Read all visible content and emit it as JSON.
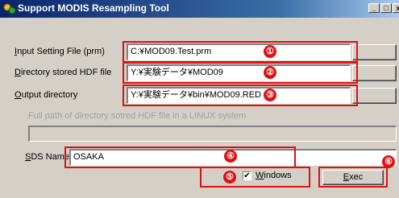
{
  "window": {
    "title": "Support MODIS Resampling Tool",
    "minimize_glyph": "_",
    "maximize_glyph": "□",
    "close_glyph": "x"
  },
  "form": {
    "input_setting": {
      "label": "Input Setting File (prm)",
      "value": "C:¥MOD09.Test.prm",
      "marker": "①"
    },
    "hdf_dir": {
      "label": "Directory stored HDF file",
      "value": "Y:¥実験データ¥MOD09",
      "marker": "②"
    },
    "output_dir": {
      "label": "Output directory",
      "value": "Y:¥実験データ¥bin¥MOD09.RED",
      "marker": "③"
    },
    "linux_path": {
      "label": "Full path of directory sotred HDF file in a LINUX system",
      "value": ""
    },
    "sds": {
      "label": "SDS Name",
      "value": "OSAKA",
      "marker": "④"
    },
    "windows_checkbox": {
      "label": "Windows",
      "checked_glyph": "✔",
      "marker": "⑤"
    },
    "exec_button": {
      "label": "Exec",
      "marker": "⑥"
    }
  },
  "colors": {
    "annotation": "#e01010",
    "title_bar": "#0a246a",
    "window_face": "#d4d0c8"
  },
  "icons": {
    "app": "app-icon"
  }
}
